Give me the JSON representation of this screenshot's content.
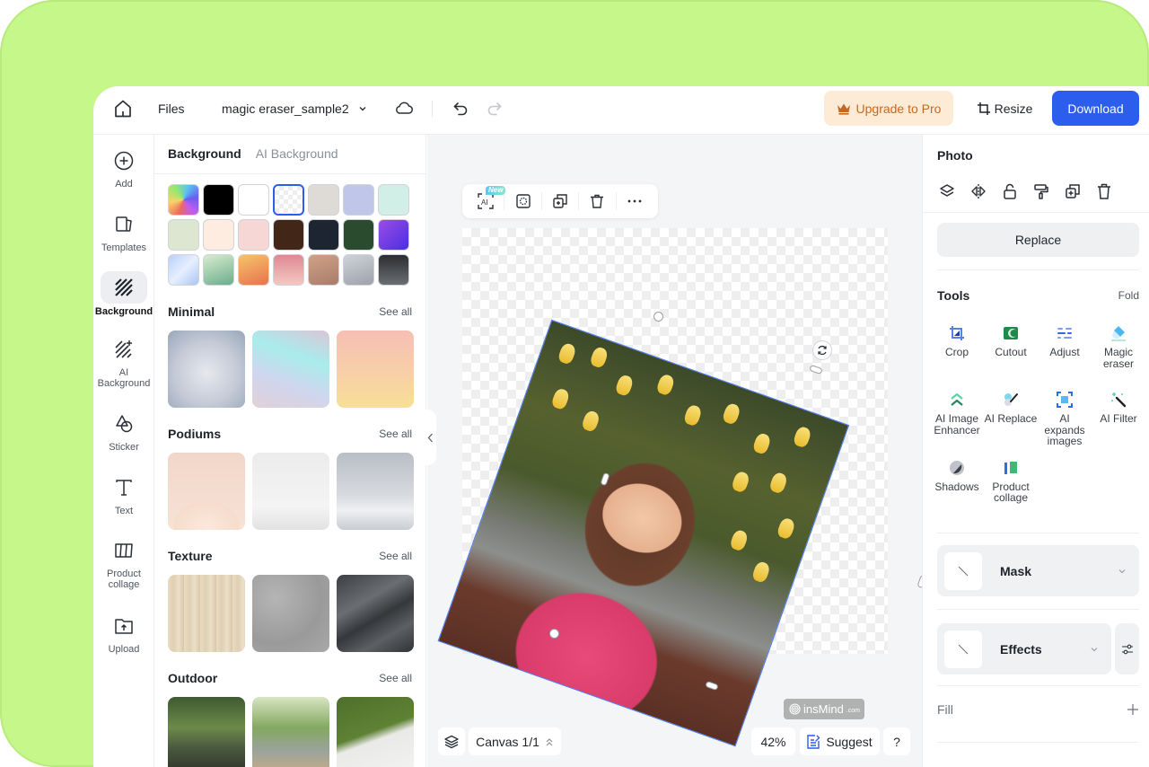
{
  "topbar": {
    "files_label": "Files",
    "file_name": "magic eraser_sample2",
    "upgrade_label": "Upgrade to Pro",
    "resize_label": "Resize",
    "download_label": "Download"
  },
  "rail": {
    "items": [
      {
        "label": "Add",
        "icon": "plus-circle-icon"
      },
      {
        "label": "Templates",
        "icon": "templates-icon"
      },
      {
        "label": "Background",
        "icon": "background-hatch-icon",
        "active": true
      },
      {
        "label": "AI Background",
        "icon": "ai-background-icon"
      },
      {
        "label": "Sticker",
        "icon": "sticker-shapes-icon"
      },
      {
        "label": "Text",
        "icon": "text-t-icon"
      },
      {
        "label": "Product collage",
        "icon": "collage-icon"
      },
      {
        "label": "Upload",
        "icon": "upload-folder-icon"
      }
    ]
  },
  "panel": {
    "tabs": [
      {
        "label": "Background",
        "active": true
      },
      {
        "label": "AI Background",
        "active": false
      }
    ],
    "swatches": [
      {
        "name": "rainbow-gradient",
        "css": "conic-gradient(from 200deg, #f06a5a, #f7d36b, #9be86a, #5ac3f0, #6b5cf0, #c05cf0, #f06a5a)"
      },
      {
        "name": "black",
        "css": "#000000"
      },
      {
        "name": "white",
        "css": "#ffffff"
      },
      {
        "name": "transparent",
        "css": "transparent",
        "selected": true
      },
      {
        "name": "warm-gray",
        "css": "#dedbd7"
      },
      {
        "name": "lavender",
        "css": "#c0c5ea"
      },
      {
        "name": "mint",
        "css": "#d2efe7"
      },
      {
        "name": "sage",
        "css": "#dde6d1"
      },
      {
        "name": "cream",
        "css": "#fdecdf"
      },
      {
        "name": "blush",
        "css": "#f7d6d6"
      },
      {
        "name": "chocolate",
        "css": "#422618"
      },
      {
        "name": "navy",
        "css": "#1e2532"
      },
      {
        "name": "forest",
        "css": "#2b4b2e"
      },
      {
        "name": "violet-gradient",
        "css": "linear-gradient(135deg,#9b4de8,#4a2ee0)"
      },
      {
        "name": "sky-gradient",
        "css": "linear-gradient(135deg,#b9cff8,#e7efff,#a9c4f2)"
      },
      {
        "name": "green-gradient",
        "css": "linear-gradient(160deg,#d9ebcf,#6aae8c)"
      },
      {
        "name": "orange-gradient",
        "css": "linear-gradient(160deg,#f5c46a,#e8724f)"
      },
      {
        "name": "rose-gradient",
        "css": "linear-gradient(180deg,#df8895,#f3c8c0)"
      },
      {
        "name": "tan-gradient",
        "css": "linear-gradient(160deg,#cfa287,#a97c6a)"
      },
      {
        "name": "silver-gradient",
        "css": "linear-gradient(160deg,#cfd3d9,#9da2ab)"
      },
      {
        "name": "charcoal-gradient",
        "css": "linear-gradient(180deg,#2b2d30,#6b6e73)"
      }
    ],
    "sections": [
      {
        "title": "Minimal",
        "see_all": "See all",
        "thumbs": [
          "radial-gradient(circle at 50% 55%, #e6e8ef 0%, #c4cad6 55%, #98a6b8 100%)",
          "linear-gradient(200deg, #d9c6d6 0%, #a9ecec 35%, #cfd6ee 65%, #e1d0d8 100%)",
          "linear-gradient(180deg, #f6bfb4 0%, #f7cfa8 55%, #f8df96 100%)"
        ]
      },
      {
        "title": "Podiums",
        "see_all": "See all",
        "thumbs": [
          "radial-gradient(ellipse 60% 45% at 50% 95%, #fbe8dc 0%, #f6dccb 70%, transparent 72%), linear-gradient(180deg,#f2d7c9,#f7e2d6)",
          "linear-gradient(180deg,#ececec 0%,#f4f4f4 70%,#e2e2e2 100%)",
          "linear-gradient(180deg,#b9bdc6 0%,#d7dade 55%,#eef0f2 75%,#c9ccd2 100%)"
        ]
      },
      {
        "title": "Texture",
        "see_all": "See all",
        "thumbs": [
          "repeating-linear-gradient(90deg,#e9dcc4 0px,#dfcfb3 6px,#ecdfc9 12px,#d9c7a9 18px)",
          "radial-gradient(circle at 30% 30%, #b5b5b5, #9a9a9a 60%, #a8a8a8)",
          "linear-gradient(150deg,#3c3f42 0%,#6a6e72 35%,#34383b 55%,#5c6064 75%,#2f3336 100%)"
        ]
      },
      {
        "title": "Outdoor",
        "see_all": "See all",
        "thumbs": [
          "linear-gradient(180deg,#3e5a32 0%,#6d8a4a 40%,#4b5a3f 65%,#2c3328 100%)",
          "linear-gradient(180deg,#d7e5c3 0%,#84a860 40%,#9aa39c 70%,#c9ad84 100%)",
          "linear-gradient(160deg,#4e6f2c 0%,#5e8234 45%,#e9eae7 55%,#f3f3f1 100%)"
        ]
      }
    ]
  },
  "canvas": {
    "float_toolbar": {
      "new_badge": "New",
      "buttons": [
        "ai-select-icon",
        "select-frame-icon",
        "duplicate-icon",
        "trash-icon",
        "more-dots-icon"
      ]
    },
    "watermark": {
      "brand": "insMind",
      "suffix": ".com"
    },
    "bottom": {
      "canvas_label": "Canvas 1/1",
      "zoom": "42%",
      "suggest_label": "Suggest",
      "help_label": "?"
    }
  },
  "props": {
    "title": "Photo",
    "actions": [
      "layers-icon",
      "flip-icon",
      "unlock-icon",
      "paint-roller-icon",
      "duplicate-icon",
      "trash-icon"
    ],
    "replace_label": "Replace",
    "tools_title": "Tools",
    "fold_label": "Fold",
    "tools": [
      {
        "label": "Crop",
        "icon": "crop-icon"
      },
      {
        "label": "Cutout",
        "icon": "cutout-icon"
      },
      {
        "label": "Adjust",
        "icon": "adjust-icon"
      },
      {
        "label": "Magic eraser",
        "icon": "eraser-icon"
      },
      {
        "label": "AI Image Enhancer",
        "icon": "enhancer-icon"
      },
      {
        "label": "AI Replace",
        "icon": "ai-replace-icon"
      },
      {
        "label": "AI expands images",
        "icon": "expand-icon"
      },
      {
        "label": "AI Filter",
        "icon": "magic-wand-icon"
      },
      {
        "label": "Shadows",
        "icon": "shadows-icon"
      },
      {
        "label": "Product collage",
        "icon": "product-collage-icon"
      }
    ],
    "mask_label": "Mask",
    "effects_label": "Effects",
    "fill_label": "Fill"
  },
  "colors": {
    "accent": "#2c5ded",
    "upgrade_bg": "#fdebd5",
    "upgrade_text": "#c8681e",
    "backdrop": "#c5f78a",
    "selection": "#4b7bf5"
  }
}
